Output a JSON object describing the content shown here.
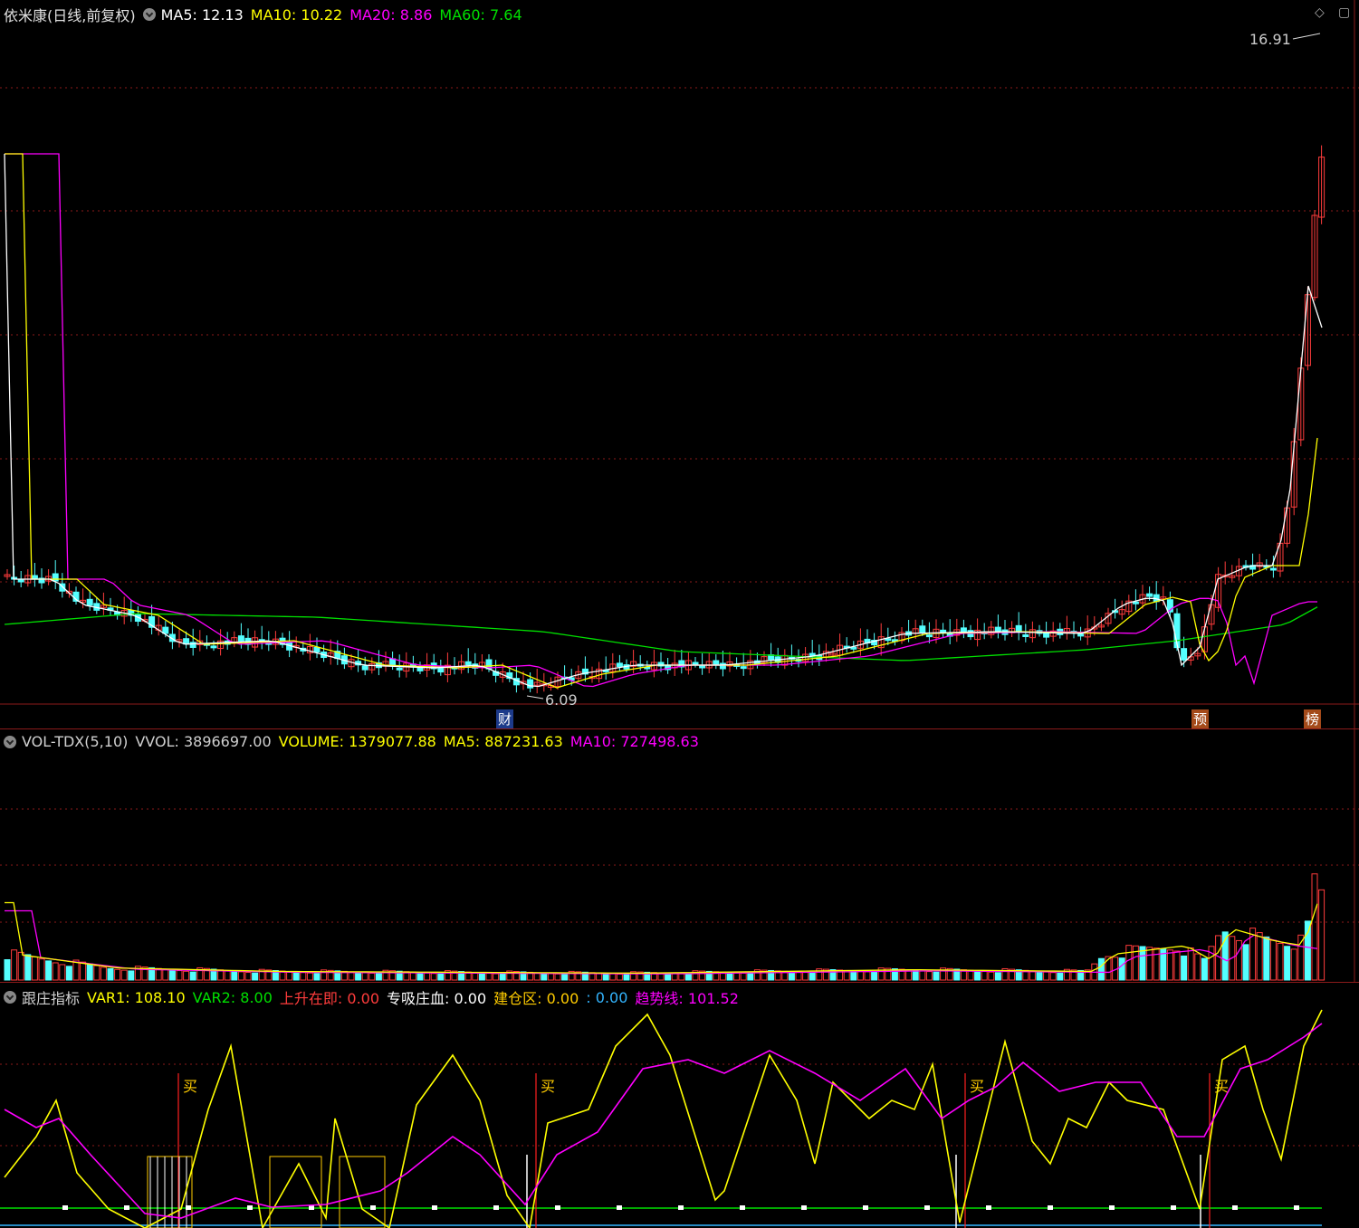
{
  "main": {
    "title": "依米康(日线,前复权)",
    "ma5": "MA5: 12.13",
    "ma10": "MA10: 10.22",
    "ma20": "MA20: 8.86",
    "ma60": "MA60: 7.64",
    "high_label": "16.91",
    "low_label": "6.09",
    "markers": [
      "财",
      "预",
      "榜"
    ]
  },
  "volume": {
    "name": "VOL-TDX(5,10)",
    "vvol": "VVOL: 3896697.00",
    "volume": "VOLUME: 1379077.88",
    "ma5": "MA5: 887231.63",
    "ma10": "MA10: 727498.63"
  },
  "indicator": {
    "name": "跟庄指标",
    "var1": "VAR1: 108.10",
    "var2": "VAR2: 8.00",
    "rise_label": "上升在即",
    "rise_value": ": 0.00",
    "absorb_label": "专吸庄血",
    "absorb_value": ": 0.00",
    "build_label": "建仓区",
    "build_value": ": 0.00",
    "build_value2": ": 0.00",
    "trend_label": "趋势线",
    "trend_value": ": 101.52",
    "buy_label": "买"
  },
  "colors": {
    "up": "#ff3c3c",
    "down": "#54ffff",
    "ma5": "#ffffff",
    "ma10": "#ffff00",
    "ma20": "#ff00ff",
    "ma60": "#00e000",
    "grid": "#8b1a1a"
  }
}
